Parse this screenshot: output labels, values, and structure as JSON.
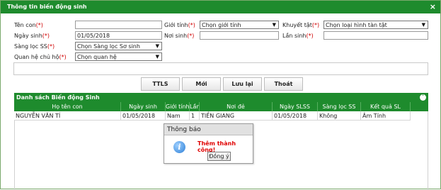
{
  "window": {
    "title": "Thông tin biến động sinh",
    "close_glyph": "×"
  },
  "form": {
    "required_mark": "(*)",
    "ten_con": {
      "label": "Tên con",
      "value": ""
    },
    "gioi_tinh": {
      "label": "Giới tính",
      "value": "Chọn giới tính"
    },
    "khuyet_tat": {
      "label": "Khuyết tật",
      "value": "Chọn loại hình tàn tật"
    },
    "ngay_sinh": {
      "label": "Ngày sinh",
      "value": "01/05/2018"
    },
    "noi_sinh": {
      "label": "Nơi sinh",
      "value": ""
    },
    "lan_sinh": {
      "label": "Lần sinh",
      "value": ""
    },
    "sang_loc": {
      "label": "Sàng lọc SS",
      "value": "Chọn Sàng lọc Sơ sinh"
    },
    "quan_he": {
      "label": "Quan hệ chủ hộ",
      "value": "Chọn quan hệ"
    },
    "dropdown_arrow": "▼"
  },
  "buttons": {
    "ttls": "TTLS",
    "moi": "Mới",
    "luu_lai": "Lưu lại",
    "thoat": "Thoát"
  },
  "grid": {
    "title": "Danh sách Biến động Sinh",
    "collapse_glyph": "˄",
    "columns": [
      "Họ tên con",
      "Ngày sinh",
      "Giới tính",
      "Lần",
      "Nơi đẻ",
      "Ngày SLSS",
      "Sàng lọc SS",
      "Kết quả SL"
    ],
    "rows": [
      [
        "NGUYỄN VĂN TÍ",
        "01/05/2018",
        "Nam",
        "1",
        "TIỀN GIANG",
        "01/05/2018",
        "Không",
        "Âm Tính"
      ]
    ]
  },
  "dialog": {
    "title": "Thông báo",
    "message": "Thêm thành công!",
    "ok_label": "Đồng ý",
    "icon_glyph": "i"
  }
}
